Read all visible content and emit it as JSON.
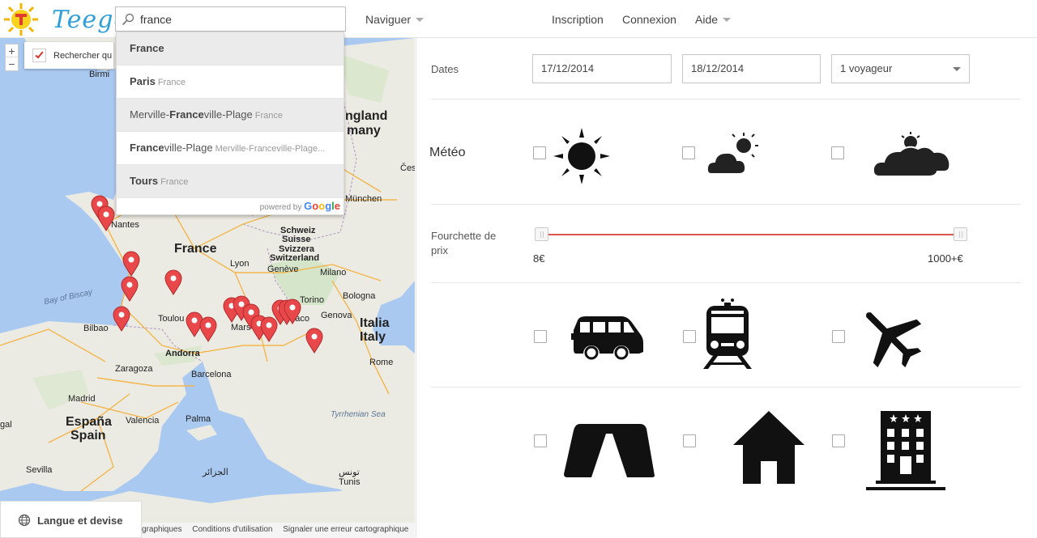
{
  "header": {
    "logo_text": "Teego",
    "search_value": "france",
    "nav": {
      "browse": "Naviguer",
      "signup": "Inscription",
      "login": "Connexion",
      "help": "Aide"
    }
  },
  "autocomplete": {
    "items": [
      {
        "main_pre": "",
        "main_match": "France",
        "main_post": "",
        "secondary": ""
      },
      {
        "main_pre": "",
        "main_match": "Paris",
        "main_post": "",
        "secondary": "France"
      },
      {
        "main_pre": "Merville-",
        "main_match": "France",
        "main_post": "ville-Plage",
        "secondary": "France"
      },
      {
        "main_pre": "",
        "main_match": "France",
        "main_post": "ville-Plage",
        "secondary": "Merville-Franceville-Plage..."
      },
      {
        "main_pre": "",
        "main_match": "Tours",
        "main_post": "",
        "secondary": "France"
      }
    ],
    "powered_by": "powered by",
    "google_letters": [
      "G",
      "o",
      "o",
      "g",
      "l",
      "e"
    ]
  },
  "map": {
    "zoom_in": "+",
    "zoom_out": "−",
    "search_here_label": "Rechercher qu",
    "labels": {
      "birmingham": "Birmi",
      "england": "ngland",
      "many": "many",
      "ceskarep": "Česk",
      "nantes": "Nantes",
      "france": "France",
      "munchen": "München",
      "schweiz": "Schweiz",
      "suisse": "Suisse",
      "svizzera": "Svizzera",
      "switzerland": "Switzerland",
      "lyon": "Lyon",
      "geneve": "Genève",
      "milano": "Milano",
      "bayofbiscay": "Bay of Biscay",
      "bologna": "Bologna",
      "torino": "Torino",
      "genova": "Genova",
      "toulouse": "Toulou",
      "bilbao": "Bilbao",
      "marseille": "Mars",
      "monaco": "onaco",
      "italia": "Italia",
      "italy": "Italy",
      "andorra": "Andorra",
      "zaragoza": "Zaragoza",
      "barcelona": "Barcelona",
      "roma": "Rome",
      "madrid": "Madrid",
      "espana": "España",
      "spain": "Spain",
      "valencia": "Valencia",
      "palma": "Palma",
      "tyrrhenian": "Tyrrhenian Sea",
      "sevilla": "Sevilla",
      "algiers_ar": "الجزائر",
      "tunis_ar": "تونس",
      "tunis": "Tunis",
      "gal": "gal"
    },
    "lang_button": "Langue et devise",
    "footer": [
      "graphiques",
      "Conditions d'utilisation",
      "Signaler une erreur cartographique"
    ]
  },
  "filters": {
    "dates_label": "Dates",
    "date_from": "17/12/2014",
    "date_to": "18/12/2014",
    "travelers": "1 voyageur",
    "weather_label": "Météo",
    "price_label_line1": "Fourchette de",
    "price_label_line2": "prix",
    "price_min": "8€",
    "price_max": "1000+€",
    "weather_options": [
      "sun-icon",
      "partly-cloudy-icon",
      "cloudy-icon"
    ],
    "transport_options": [
      "van-icon",
      "train-icon",
      "plane-icon"
    ],
    "lodging_options": [
      "tent-icon",
      "house-icon",
      "hotel-icon"
    ],
    "slider_min_fraction": 0.0,
    "slider_max_fraction": 1.0
  },
  "colors": {
    "accent_red": "#d9534f",
    "map_water": "#a9c9f1",
    "map_land": "#ecebe3",
    "pin": "#e8484a",
    "logo_blue": "#2e9fd8"
  }
}
